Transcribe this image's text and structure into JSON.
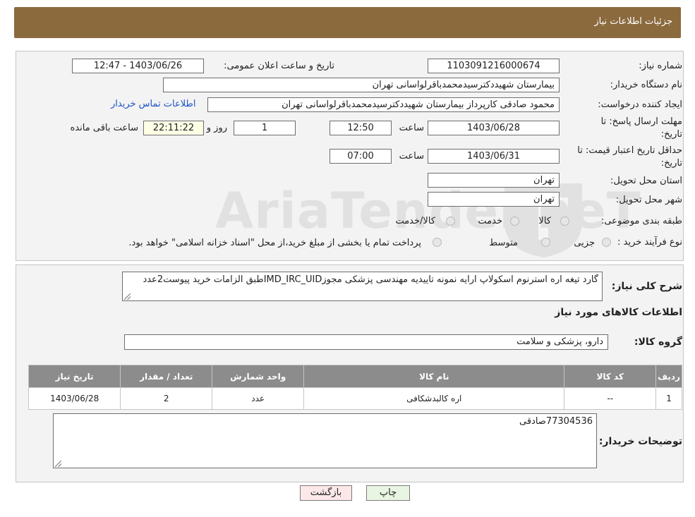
{
  "header": {
    "title": "جزئیات اطلاعات نیاز"
  },
  "need": {
    "number_label": "شماره نیاز:",
    "number": "1103091216000674",
    "announce_label": "تاریخ و ساعت اعلان عمومی:",
    "announce": "1403/06/26 - 12:47",
    "buyer_org_label": "نام دستگاه خریدار:",
    "buyer_org": "بیمارستان شهیددکترسیدمحمدباقرلواسانی تهران",
    "creator_label": "ایجاد کننده درخواست:",
    "creator": "محمود صادقی کارپرداز بیمارستان شهیددکترسیدمحمدباقرلواسانی تهران",
    "contact_link": "اطلاعات تماس خریدار",
    "deadline_label_1": "مهلت ارسال پاسخ: تا",
    "deadline_label_2": "تاریخ:",
    "deadline_date": "1403/06/28",
    "time_label": "ساعت",
    "deadline_time": "12:50",
    "days": "1",
    "days_label": "روز و",
    "remaining": "22:11:22",
    "remaining_label": "ساعت باقی مانده",
    "validity_label_1": "حداقل تاریخ اعتبار قیمت: تا",
    "validity_label_2": "تاریخ:",
    "validity_date": "1403/06/31",
    "validity_time": "07:00",
    "province_label": "استان محل تحویل:",
    "province": "تهران",
    "city_label": "شهر محل تحویل:",
    "city": "تهران",
    "category_label": "طبقه بندی موضوعی:",
    "category_options": [
      "کالا",
      "خدمت",
      "کالا/خدمت"
    ],
    "process_label": "نوع فرآیند خرید :",
    "process_options": [
      "جزیی",
      "متوسط"
    ],
    "process_note": "پرداخت تمام یا بخشی از مبلغ خرید،از محل \"اسناد خزانه اسلامی\" خواهد بود."
  },
  "description": {
    "label": "شرح کلی نیاز:",
    "text": "گارد تیغه اره استرنوم اسکولاپ ارایه نمونه تاییدیه مهندسی پزشکی مجوزIMD_IRC_UIDطبق الزامات خرید پیوست2عدد"
  },
  "goods": {
    "section_title": "اطلاعات کالاهای مورد نیاز",
    "group_label": "گروه کالا:",
    "group": "دارو، پزشکی و سلامت",
    "columns": [
      "ردیف",
      "کد کالا",
      "نام کالا",
      "واحد شمارش",
      "تعداد / مقدار",
      "تاریخ نیاز"
    ],
    "rows": [
      [
        "1",
        "--",
        "اره کالبدشکافی",
        "عدد",
        "2",
        "1403/06/28"
      ]
    ]
  },
  "buyer_notes": {
    "label": "توضیحات خریدار:",
    "text": "77304536صادقی"
  },
  "buttons": {
    "print": "چاپ",
    "back": "بازگشت"
  },
  "watermark": {
    "text": "AriaTender.neT"
  }
}
